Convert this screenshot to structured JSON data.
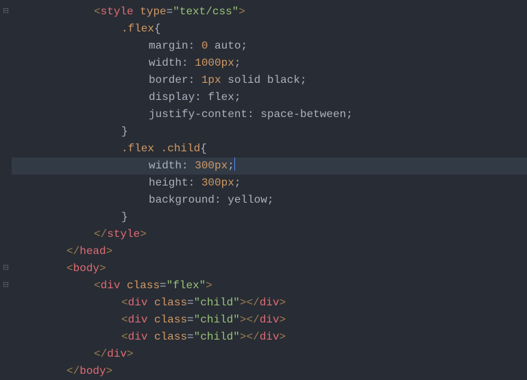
{
  "gutter_marks": [
    {
      "row": 0,
      "glyph": "⊟"
    },
    {
      "row": 15,
      "glyph": "⊟"
    },
    {
      "row": 16,
      "glyph": "⊟"
    }
  ],
  "highlighted_line_index": 9,
  "code": {
    "lines": [
      {
        "indent": 8,
        "tokens": [
          {
            "t": "<",
            "c": "bracket"
          },
          {
            "t": "style",
            "c": "tag"
          },
          {
            "t": " ",
            "c": "punct"
          },
          {
            "t": "type",
            "c": "attr"
          },
          {
            "t": "=",
            "c": "punct"
          },
          {
            "t": "\"text/css\"",
            "c": "string"
          },
          {
            "t": ">",
            "c": "bracket"
          }
        ]
      },
      {
        "indent": 12,
        "tokens": [
          {
            "t": ".flex",
            "c": "selector"
          },
          {
            "t": "{",
            "c": "brace"
          }
        ]
      },
      {
        "indent": 16,
        "tokens": [
          {
            "t": "margin",
            "c": "prop"
          },
          {
            "t": ": ",
            "c": "punct"
          },
          {
            "t": "0",
            "c": "num"
          },
          {
            "t": " ",
            "c": "punct"
          },
          {
            "t": "auto",
            "c": "val"
          },
          {
            "t": ";",
            "c": "punct"
          }
        ]
      },
      {
        "indent": 16,
        "tokens": [
          {
            "t": "width",
            "c": "prop"
          },
          {
            "t": ": ",
            "c": "punct"
          },
          {
            "t": "1000px",
            "c": "num"
          },
          {
            "t": ";",
            "c": "punct"
          }
        ]
      },
      {
        "indent": 16,
        "tokens": [
          {
            "t": "border",
            "c": "prop"
          },
          {
            "t": ": ",
            "c": "punct"
          },
          {
            "t": "1px",
            "c": "num"
          },
          {
            "t": " solid black",
            "c": "val"
          },
          {
            "t": ";",
            "c": "punct"
          }
        ]
      },
      {
        "indent": 16,
        "tokens": [
          {
            "t": "display",
            "c": "prop"
          },
          {
            "t": ": ",
            "c": "punct"
          },
          {
            "t": "flex",
            "c": "val"
          },
          {
            "t": ";",
            "c": "punct"
          }
        ]
      },
      {
        "indent": 16,
        "tokens": [
          {
            "t": "justify-content",
            "c": "prop"
          },
          {
            "t": ": ",
            "c": "punct"
          },
          {
            "t": "space-between",
            "c": "val"
          },
          {
            "t": ";",
            "c": "punct"
          }
        ]
      },
      {
        "indent": 12,
        "tokens": [
          {
            "t": "}",
            "c": "brace"
          }
        ]
      },
      {
        "indent": 12,
        "tokens": [
          {
            "t": ".flex",
            "c": "selector"
          },
          {
            "t": " ",
            "c": "punct"
          },
          {
            "t": ".child",
            "c": "selector"
          },
          {
            "t": "{",
            "c": "brace"
          }
        ]
      },
      {
        "indent": 16,
        "tokens": [
          {
            "t": "width",
            "c": "prop"
          },
          {
            "t": ": ",
            "c": "punct"
          },
          {
            "t": "300px",
            "c": "num"
          },
          {
            "t": ";",
            "c": "punct"
          }
        ],
        "caret_after": true
      },
      {
        "indent": 16,
        "tokens": [
          {
            "t": "height",
            "c": "prop"
          },
          {
            "t": ": ",
            "c": "punct"
          },
          {
            "t": "300px",
            "c": "num"
          },
          {
            "t": ";",
            "c": "punct"
          }
        ]
      },
      {
        "indent": 16,
        "tokens": [
          {
            "t": "background",
            "c": "prop"
          },
          {
            "t": ": ",
            "c": "punct"
          },
          {
            "t": "yellow",
            "c": "val"
          },
          {
            "t": ";",
            "c": "punct"
          }
        ]
      },
      {
        "indent": 12,
        "tokens": [
          {
            "t": "}",
            "c": "brace"
          }
        ]
      },
      {
        "indent": 8,
        "tokens": [
          {
            "t": "<",
            "c": "bracket"
          },
          {
            "t": "/",
            "c": "bracket"
          },
          {
            "t": "style",
            "c": "tag"
          },
          {
            "t": ">",
            "c": "bracket"
          }
        ]
      },
      {
        "indent": 4,
        "tokens": [
          {
            "t": "<",
            "c": "bracket"
          },
          {
            "t": "/",
            "c": "bracket"
          },
          {
            "t": "head",
            "c": "tag"
          },
          {
            "t": ">",
            "c": "bracket"
          }
        ]
      },
      {
        "indent": 4,
        "tokens": [
          {
            "t": "<",
            "c": "bracket"
          },
          {
            "t": "body",
            "c": "tag"
          },
          {
            "t": ">",
            "c": "bracket"
          }
        ]
      },
      {
        "indent": 8,
        "tokens": [
          {
            "t": "<",
            "c": "bracket"
          },
          {
            "t": "div",
            "c": "tag"
          },
          {
            "t": " ",
            "c": "punct"
          },
          {
            "t": "class",
            "c": "attr"
          },
          {
            "t": "=",
            "c": "punct"
          },
          {
            "t": "\"flex\"",
            "c": "string"
          },
          {
            "t": ">",
            "c": "bracket"
          }
        ]
      },
      {
        "indent": 12,
        "tokens": [
          {
            "t": "<",
            "c": "bracket"
          },
          {
            "t": "div",
            "c": "tag"
          },
          {
            "t": " ",
            "c": "punct"
          },
          {
            "t": "class",
            "c": "attr"
          },
          {
            "t": "=",
            "c": "punct"
          },
          {
            "t": "\"child\"",
            "c": "string"
          },
          {
            "t": ">",
            "c": "bracket"
          },
          {
            "t": "<",
            "c": "bracket"
          },
          {
            "t": "/",
            "c": "bracket"
          },
          {
            "t": "div",
            "c": "tag"
          },
          {
            "t": ">",
            "c": "bracket"
          }
        ]
      },
      {
        "indent": 12,
        "tokens": [
          {
            "t": "<",
            "c": "bracket"
          },
          {
            "t": "div",
            "c": "tag"
          },
          {
            "t": " ",
            "c": "punct"
          },
          {
            "t": "class",
            "c": "attr"
          },
          {
            "t": "=",
            "c": "punct"
          },
          {
            "t": "\"child\"",
            "c": "string"
          },
          {
            "t": ">",
            "c": "bracket"
          },
          {
            "t": "<",
            "c": "bracket"
          },
          {
            "t": "/",
            "c": "bracket"
          },
          {
            "t": "div",
            "c": "tag"
          },
          {
            "t": ">",
            "c": "bracket"
          }
        ]
      },
      {
        "indent": 12,
        "tokens": [
          {
            "t": "<",
            "c": "bracket"
          },
          {
            "t": "div",
            "c": "tag"
          },
          {
            "t": " ",
            "c": "punct"
          },
          {
            "t": "class",
            "c": "attr"
          },
          {
            "t": "=",
            "c": "punct"
          },
          {
            "t": "\"child\"",
            "c": "string"
          },
          {
            "t": ">",
            "c": "bracket"
          },
          {
            "t": "<",
            "c": "bracket"
          },
          {
            "t": "/",
            "c": "bracket"
          },
          {
            "t": "div",
            "c": "tag"
          },
          {
            "t": ">",
            "c": "bracket"
          }
        ]
      },
      {
        "indent": 8,
        "tokens": [
          {
            "t": "<",
            "c": "bracket"
          },
          {
            "t": "/",
            "c": "bracket"
          },
          {
            "t": "div",
            "c": "tag"
          },
          {
            "t": ">",
            "c": "bracket"
          }
        ]
      },
      {
        "indent": 4,
        "tokens": [
          {
            "t": "<",
            "c": "bracket"
          },
          {
            "t": "/",
            "c": "bracket"
          },
          {
            "t": "body",
            "c": "tag"
          },
          {
            "t": ">",
            "c": "bracket"
          }
        ]
      }
    ]
  }
}
